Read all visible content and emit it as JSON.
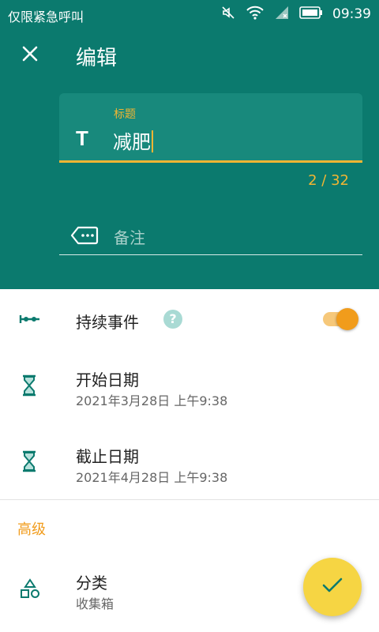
{
  "status_bar": {
    "carrier": "仅限紧急呼叫",
    "time": "09:39",
    "icons": [
      "mute-icon",
      "wifi-icon",
      "signal-icon",
      "battery-icon"
    ]
  },
  "top_bar": {
    "close_icon": "close-icon",
    "title": "编辑"
  },
  "title_field": {
    "label": "标题",
    "value": "减肥",
    "counter": "2 / 32",
    "icon": "text-t-icon"
  },
  "notes_field": {
    "placeholder": "备注",
    "icon": "label-tag-icon"
  },
  "duration_event": {
    "label": "持续事件",
    "help": "?",
    "enabled": true,
    "icon": "duration-icon"
  },
  "start_date": {
    "label": "开始日期",
    "value": "2021年3月28日 上午9:38",
    "icon": "hourglass-icon"
  },
  "end_date": {
    "label": "截止日期",
    "value": "2021年4月28日 上午9:38",
    "icon": "hourglass-icon"
  },
  "advanced": {
    "section_title": "高级",
    "category_label": "分类",
    "category_value": "收集箱",
    "category_icon": "shapes-icon"
  },
  "fab": {
    "icon": "check-icon"
  },
  "colors": {
    "primary": "#0b7a6e",
    "accent": "#f1b533",
    "toggle": "#f19c1c",
    "fab": "#f6d543"
  }
}
